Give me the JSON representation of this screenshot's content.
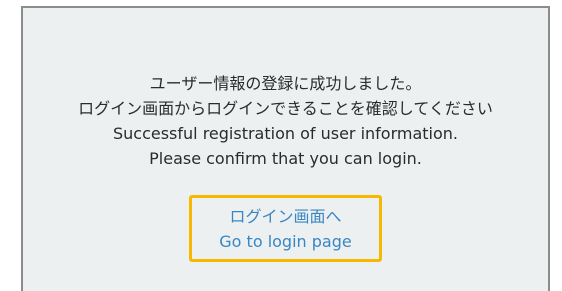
{
  "message": {
    "line1": "ユーザー情報の登録に成功しました。",
    "line2": "ログイン画面からログインできることを確認してください",
    "line3": "Successful registration of user information.",
    "line4": "Please confirm that you can login."
  },
  "login_link": {
    "label_ja": "ログイン画面へ",
    "label_en": "Go to login page",
    "highlight_color": "#f6b800",
    "link_color": "#3a86c4"
  }
}
